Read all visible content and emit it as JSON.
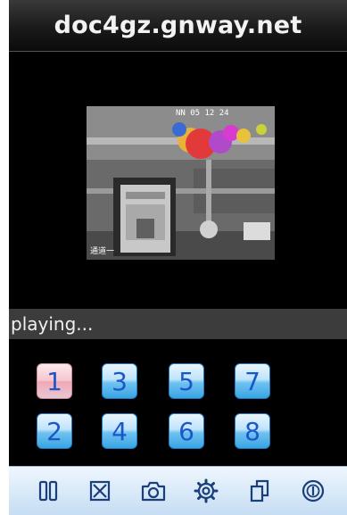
{
  "app": {
    "title": "doc4gz.gnway.net"
  },
  "video": {
    "osd_top": "NN 05 12 24",
    "osd_bottom": "通道一"
  },
  "status": {
    "text": "playing..."
  },
  "channels": [
    {
      "label": "1",
      "active": true
    },
    {
      "label": "3",
      "active": false
    },
    {
      "label": "5",
      "active": false
    },
    {
      "label": "7",
      "active": false
    },
    {
      "label": "2",
      "active": false
    },
    {
      "label": "4",
      "active": false
    },
    {
      "label": "6",
      "active": false
    },
    {
      "label": "8",
      "active": false
    }
  ],
  "toolbar": {
    "icons": [
      "pause-icon",
      "stop-icon",
      "camera-icon",
      "gear-icon",
      "copy-icon",
      "info-icon"
    ]
  },
  "colors": {
    "button_blue": "#39a4e4",
    "button_digit": "#1b57c9",
    "button_active_pink": "#f0a9b6",
    "toolbar_bg": "#d8e9f8",
    "icon_color": "#1b3f7a"
  }
}
